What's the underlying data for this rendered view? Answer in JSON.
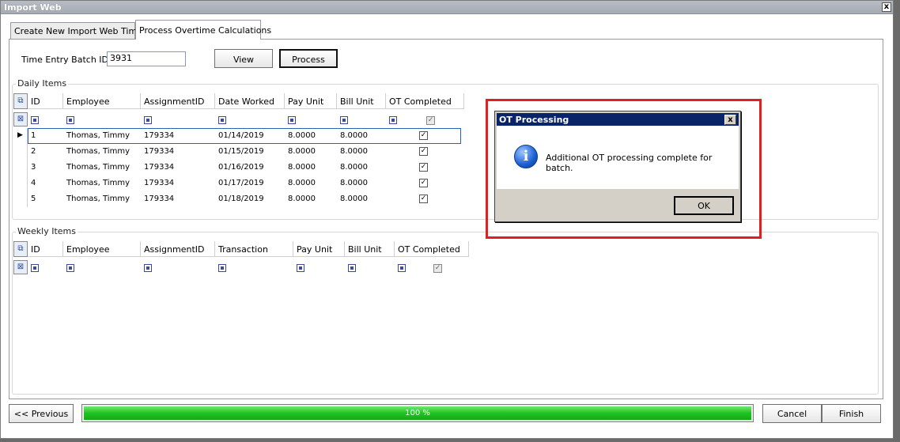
{
  "window": {
    "title": "Import Web",
    "close_glyph": "x"
  },
  "tabs": [
    {
      "label": "Create New Import Web Time",
      "active": false
    },
    {
      "label": "Process Overtime Calculations",
      "active": true
    }
  ],
  "batch": {
    "label": "Time Entry Batch ID:",
    "value": "3931",
    "view_label": "View",
    "process_label": "Process"
  },
  "daily": {
    "title": "Daily Items",
    "columns": [
      "ID",
      "Employee",
      "AssignmentID",
      "Date Worked",
      "Pay Unit",
      "Bill Unit",
      "OT Completed"
    ],
    "rows": [
      [
        "1",
        "Thomas, Timmy",
        "179334",
        "01/14/2019",
        "8.0000",
        "8.0000",
        true
      ],
      [
        "2",
        "Thomas, Timmy",
        "179334",
        "01/15/2019",
        "8.0000",
        "8.0000",
        true
      ],
      [
        "3",
        "Thomas, Timmy",
        "179334",
        "01/16/2019",
        "8.0000",
        "8.0000",
        true
      ],
      [
        "4",
        "Thomas, Timmy",
        "179334",
        "01/17/2019",
        "8.0000",
        "8.0000",
        true
      ],
      [
        "5",
        "Thomas, Timmy",
        "179334",
        "01/18/2019",
        "8.0000",
        "8.0000",
        true
      ]
    ],
    "selected_row": 0
  },
  "weekly": {
    "title": "Weekly Items",
    "columns": [
      "ID",
      "Employee",
      "AssignmentID",
      "Transaction",
      "Pay Unit",
      "Bill Unit",
      "OT Completed"
    ],
    "rows": []
  },
  "footer": {
    "previous_label": "<< Previous",
    "progress_value": 100,
    "progress_text": "100 %",
    "cancel_label": "Cancel",
    "finish_label": "Finish"
  },
  "dialog": {
    "title": "OT Processing",
    "message": "Additional OT processing complete for batch.",
    "ok_label": "OK",
    "icon": "info-icon",
    "close_glyph": "x"
  },
  "colors": {
    "progress_fill": "#1fc41f",
    "dialog_title_bg": "#0a246a",
    "highlight_border": "#e02020"
  }
}
